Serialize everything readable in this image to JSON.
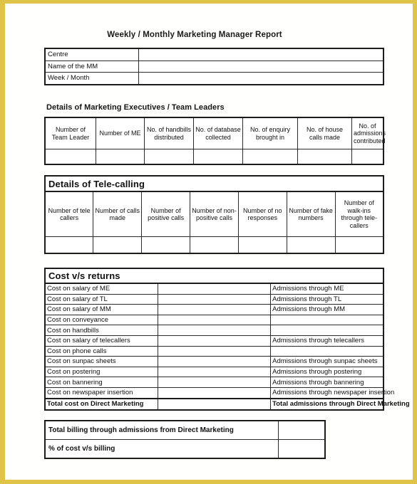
{
  "page": {
    "frame_color": "#e0c44a",
    "background": "#ffffff",
    "title": "Weekly / Monthly Marketing Manager Report"
  },
  "centre_table": {
    "rows": [
      {
        "label": "Centre",
        "value": ""
      },
      {
        "label": "Name of the MM",
        "value": ""
      },
      {
        "label": "Week / Month",
        "value": ""
      }
    ]
  },
  "marketing_executives": {
    "heading": "Details of Marketing Executives / Team Leaders",
    "headers": [
      "Number of Team Leader",
      "Number of ME",
      "No. of handbills distributed",
      "No. of database collected",
      "No. of enquiry brought in",
      "No. of house calls made",
      "No. of admissions contributed"
    ],
    "values": [
      "",
      "",
      "",
      "",
      "",
      "",
      ""
    ]
  },
  "tele_calling": {
    "heading": "Details of Tele-calling",
    "headers": [
      "Number of tele callers",
      "Number of calls made",
      "Number of positive calls",
      "Number of non-positive calls",
      "Number of no responses",
      "Number of fake numbers",
      "Number of walk-ins through tele-callers"
    ],
    "values": [
      "",
      "",
      "",
      "",
      "",
      "",
      ""
    ]
  },
  "cost_vs_returns": {
    "heading": "Cost v/s returns",
    "rows": [
      {
        "cost_label": "Cost on salary of ME",
        "cost_value": "",
        "return_label": "Admissions through ME",
        "return_value": ""
      },
      {
        "cost_label": "Cost on salary of TL",
        "cost_value": "",
        "return_label": "Admissions through TL",
        "return_value": ""
      },
      {
        "cost_label": "Cost on salary of MM",
        "cost_value": "",
        "return_label": "Admissions through MM",
        "return_value": ""
      },
      {
        "cost_label": "Cost on conveyance",
        "cost_value": "",
        "return_label": "",
        "return_value": ""
      },
      {
        "cost_label": "Cost on handbills",
        "cost_value": "",
        "return_label": "",
        "return_value": ""
      },
      {
        "cost_label": "Cost on salary of telecallers",
        "cost_value": "",
        "return_label": "Admissions through telecallers",
        "return_value": ""
      },
      {
        "cost_label": "Cost on phone calls",
        "cost_value": "",
        "return_label": "",
        "return_value": ""
      },
      {
        "cost_label": "Cost on sunpac sheets",
        "cost_value": "",
        "return_label": "Admissions through sunpac sheets",
        "return_value": ""
      },
      {
        "cost_label": "Cost on postering",
        "cost_value": "",
        "return_label": "Admissions through postering",
        "return_value": ""
      },
      {
        "cost_label": "Cost on bannering",
        "cost_value": "",
        "return_label": "Admissions through bannering",
        "return_value": ""
      },
      {
        "cost_label": "Cost on newspaper insertion",
        "cost_value": "",
        "return_label": "Admissions through newspaper insertion",
        "return_value": ""
      }
    ],
    "total_row": {
      "cost_label": "Total cost on Direct Marketing",
      "cost_value": "",
      "return_label": "Total admissions through Direct Marketing",
      "return_value": ""
    }
  },
  "billing_table": {
    "rows": [
      {
        "label": "Total billing through admissions from Direct Marketing",
        "value": ""
      },
      {
        "label": "% of cost v/s billing",
        "value": ""
      }
    ]
  }
}
